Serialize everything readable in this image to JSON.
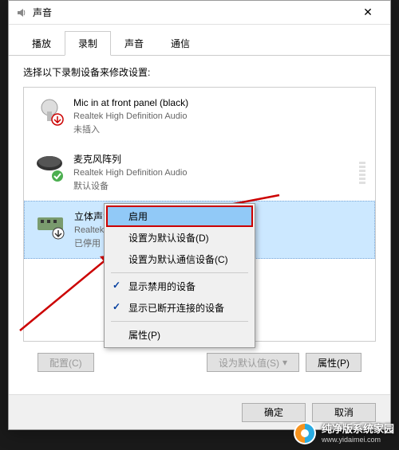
{
  "window": {
    "title": "声音"
  },
  "tabs": [
    {
      "label": "播放"
    },
    {
      "label": "录制"
    },
    {
      "label": "声音"
    },
    {
      "label": "通信"
    }
  ],
  "instruction": "选择以下录制设备来修改设置:",
  "devices": [
    {
      "name": "Mic in at front panel (black)",
      "driver": "Realtek High Definition Audio",
      "status": "未插入"
    },
    {
      "name": "麦克风阵列",
      "driver": "Realtek High Definition Audio",
      "status": "默认设备"
    },
    {
      "name": "立体声混音",
      "driver": "Realtek H",
      "status": "已停用"
    }
  ],
  "context_menu": {
    "enable": "启用",
    "set_default": "设置为默认设备(D)",
    "set_default_comm": "设置为默认通信设备(C)",
    "show_disabled": "显示禁用的设备",
    "show_disconnected": "显示已断开连接的设备",
    "properties": "属性(P)"
  },
  "buttons": {
    "configure": "配置(C)",
    "set_default_btn": "设为默认值(S)",
    "properties_btn": "属性(P)",
    "ok": "确定",
    "cancel": "取消"
  },
  "watermark": {
    "name": "纯净版系统家园",
    "url": "www.yidaimei.com"
  }
}
